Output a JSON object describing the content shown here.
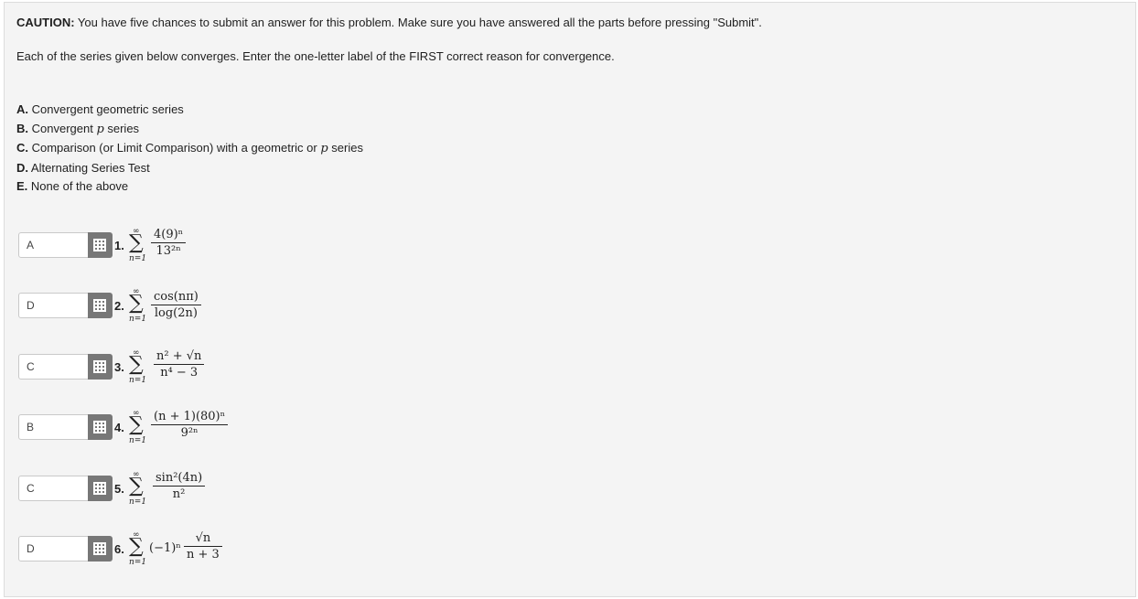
{
  "caution_label": "CAUTION:",
  "caution_text": " You have five chances to submit an answer for this problem. Make sure you have answered all the parts before pressing \"Submit\".",
  "instructions": "Each of the series given below converges. Enter the one-letter label of the FIRST correct reason for convergence.",
  "options": [
    {
      "letter": "A.",
      "text_before": " Convergent geometric series",
      "p": "",
      "text_after": ""
    },
    {
      "letter": "B.",
      "text_before": " Convergent ",
      "p": "p",
      "text_after": " series"
    },
    {
      "letter": "C.",
      "text_before": " Comparison (or Limit Comparison) with a geometric or ",
      "p": "p",
      "text_after": " series"
    },
    {
      "letter": "D.",
      "text_before": " Alternating Series Test",
      "p": "",
      "text_after": ""
    },
    {
      "letter": "E.",
      "text_before": " None of the above",
      "p": "",
      "text_after": ""
    }
  ],
  "sum_upper": "∞",
  "sum_symbol": "∑",
  "sum_lower": "n=1",
  "problems": [
    {
      "number": "1.",
      "answer": "A",
      "prefix": "",
      "numerator": "4(9)ⁿ",
      "denominator": "13²ⁿ"
    },
    {
      "number": "2.",
      "answer": "D",
      "prefix": "",
      "numerator": "cos(nπ)",
      "denominator": "log(2n)"
    },
    {
      "number": "3.",
      "answer": "C",
      "prefix": "",
      "numerator": "n² + √n",
      "denominator": "n⁴ − 3"
    },
    {
      "number": "4.",
      "answer": "B",
      "prefix": "",
      "numerator": "(n + 1)(80)ⁿ",
      "denominator": "9²ⁿ"
    },
    {
      "number": "5.",
      "answer": "C",
      "prefix": "",
      "numerator": "sin²(4n)",
      "denominator": "n²"
    },
    {
      "number": "6.",
      "answer": "D",
      "prefix": "(−1)ⁿ",
      "numerator": "√n",
      "denominator": "n + 3"
    }
  ],
  "colors": {
    "panel_bg": "#f4f4f4",
    "button_bg": "#777777",
    "input_border": "#c9c9c9"
  }
}
